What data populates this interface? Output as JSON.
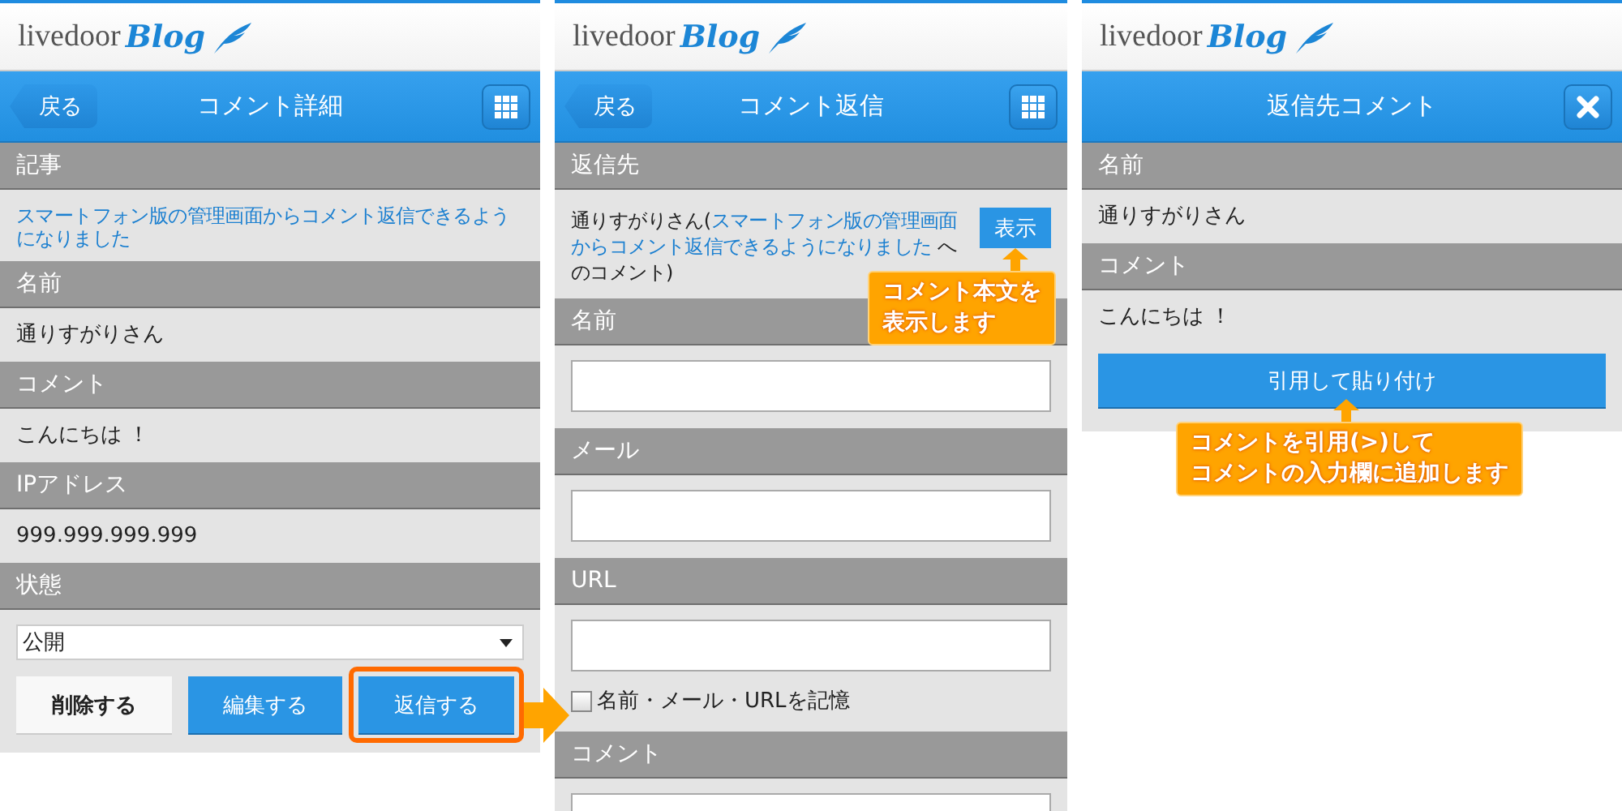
{
  "panels": [
    {
      "logo": {
        "wordmark": "livedoor",
        "script": "Blog"
      },
      "navbar": {
        "back_button": "戻る",
        "title": "コメント詳細",
        "right_button": {
          "kind": "menu"
        }
      },
      "items": [
        {
          "kind": "header",
          "text": "記事"
        },
        {
          "kind": "link",
          "text": "スマートフォン版の管理画面からコメント返信できるようになりました"
        },
        {
          "kind": "header",
          "text": "名前"
        },
        {
          "kind": "text",
          "text": "通りすがりさん"
        },
        {
          "kind": "header",
          "text": "コメント"
        },
        {
          "kind": "text",
          "text": "こんにちは ！"
        },
        {
          "kind": "header",
          "text": "IPアドレス"
        },
        {
          "kind": "text",
          "text": "999.999.999.999"
        },
        {
          "kind": "header",
          "text": "状態"
        },
        {
          "kind": "select",
          "value": "公開"
        },
        {
          "kind": "buttons",
          "buttons": [
            {
              "kind": "delete",
              "label": "削除する",
              "highlighted": false
            },
            {
              "kind": "edit",
              "label": "編集する",
              "highlighted": false
            },
            {
              "kind": "reply",
              "label": "返信する",
              "highlighted": true
            }
          ]
        }
      ]
    },
    {
      "logo": {
        "wordmark": "livedoor",
        "script": "Blog"
      },
      "navbar": {
        "back_button": "戻る",
        "title": "コメント返信",
        "right_button": {
          "kind": "menu"
        }
      },
      "items": [
        {
          "kind": "header",
          "text": "返信先"
        },
        {
          "kind": "reply_target",
          "author": "通りすがりさん(",
          "link": "スマートフォン版の管理画面からコメント返信できるようになりました",
          "suffix": " へのコメント)",
          "button": "表示",
          "callout": [
            "コメント本文を",
            "表示します"
          ]
        },
        {
          "kind": "header",
          "text": "名前"
        },
        {
          "kind": "input"
        },
        {
          "kind": "header",
          "text": "メール"
        },
        {
          "kind": "input"
        },
        {
          "kind": "header",
          "text": "URL"
        },
        {
          "kind": "input",
          "checkbox": {
            "label": "名前・メール・URLを記憶",
            "checked": false
          }
        },
        {
          "kind": "header",
          "text": "コメント"
        },
        {
          "kind": "input"
        }
      ]
    },
    {
      "logo": {
        "wordmark": "livedoor",
        "script": "Blog"
      },
      "navbar": {
        "title": "返信先コメント",
        "right_button": {
          "kind": "close"
        }
      },
      "items": [
        {
          "kind": "header",
          "text": "名前"
        },
        {
          "kind": "text",
          "text": "通りすがりさん"
        },
        {
          "kind": "header",
          "text": "コメント"
        },
        {
          "kind": "text",
          "text": "こんにちは ！"
        },
        {
          "kind": "action",
          "label": "引用して貼り付け",
          "callout": [
            "コメントを引用(>)して",
            "コメントの入力欄に追加します"
          ]
        }
      ]
    }
  ]
}
